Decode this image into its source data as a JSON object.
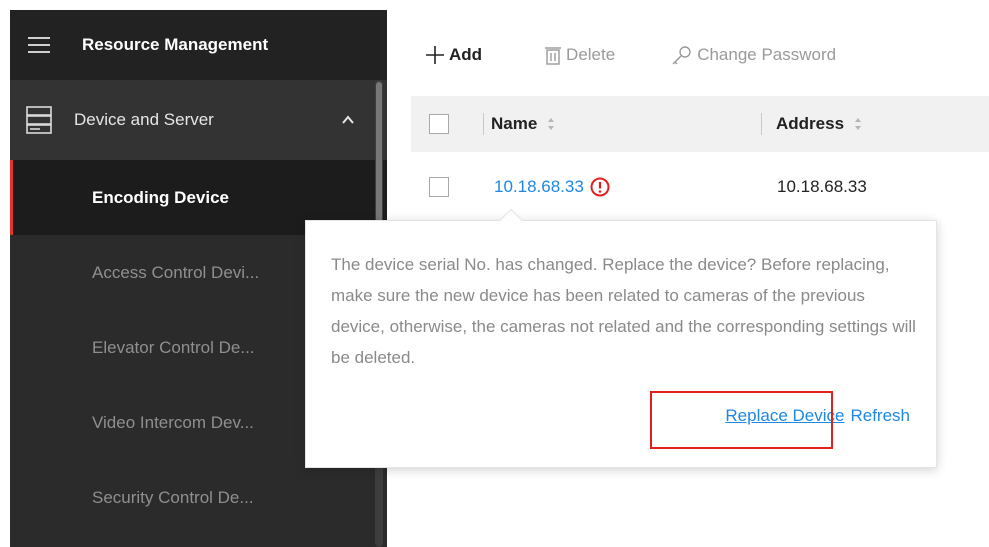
{
  "sidebar": {
    "title": "Resource Management",
    "group_label": "Device and Server",
    "items": [
      {
        "label": "Encoding Device",
        "active": true
      },
      {
        "label": "Access Control Devi...",
        "active": false
      },
      {
        "label": "Elevator Control De...",
        "active": false
      },
      {
        "label": "Video Intercom Dev...",
        "active": false
      },
      {
        "label": "Security Control De...",
        "active": false
      }
    ]
  },
  "toolbar": {
    "add_label": "Add",
    "delete_label": "Delete",
    "change_password_label": "Change Password"
  },
  "table": {
    "columns": [
      "Name",
      "Address"
    ],
    "rows": [
      {
        "name": "10.18.68.33",
        "address": "10.18.68.33"
      }
    ]
  },
  "popover": {
    "message": "The device serial No. has changed. Replace the device? Before replacing, make sure the new device has been related to cameras of the previous device, otherwise, the cameras not related and the corresponding settings will be deleted.",
    "replace_label": "Replace Device",
    "refresh_label": "Refresh"
  },
  "colors": {
    "accent_blue": "#1e88e5",
    "active_indicator": "#e1332b",
    "alert_red": "#e02020",
    "highlight_red": "#e01f1f"
  },
  "icons": {
    "menu": "hamburger-icon",
    "server": "server-icon",
    "collapse": "chevron-up-icon",
    "add": "plus-icon",
    "delete": "trash-icon",
    "change_password": "key-icon",
    "sort": "sort-icon",
    "alert": "alert-circle-icon"
  }
}
